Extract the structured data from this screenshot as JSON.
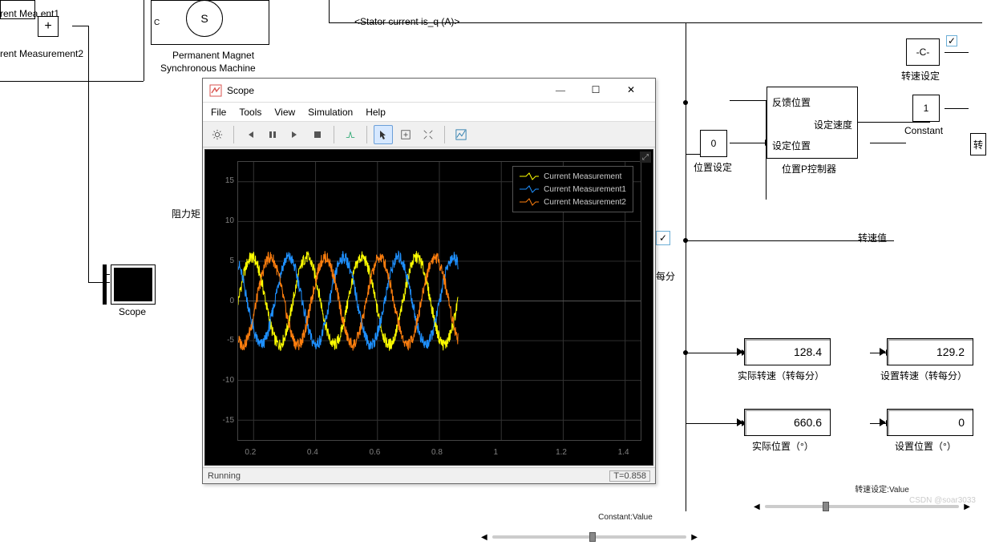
{
  "simulink": {
    "signal_label": "<Stator current is_q (A)>",
    "blocks": {
      "current_meas1": "rent Mea      ent1",
      "current_meas2": "rent Measurement2",
      "pmsm_line1": "Permanent Magnet",
      "pmsm_line2": "Synchronous Machine",
      "pmsm_symbol": "S",
      "port_C": "C",
      "resistance_torque": "阻力矩",
      "scope_block": "Scope",
      "pos_controller_block": "位置P控制器",
      "pos_setpoint": "位置设定",
      "feedback_pos": "反馈位置",
      "set_speed": "设定速度",
      "set_position": "设定位置",
      "speed_setpoint_block": "转速设定",
      "const_C": "-C-",
      "constant_block": "Constant",
      "constant_1": "1",
      "constant_0": "0",
      "speed_value_label": "转速值",
      "per_minute": "每分",
      "partial_gain": "转"
    },
    "displays": {
      "actual_speed": {
        "value": "128.4",
        "label": "实际转速（转每分）"
      },
      "set_speed": {
        "value": "129.2",
        "label": "设置转速（转每分）"
      },
      "actual_pos": {
        "value": "660.6",
        "label": "实际位置（°）"
      },
      "set_pos": {
        "value": "0",
        "label": "设置位置（°）"
      }
    },
    "sliders": {
      "speed": "转速设定:Value",
      "constant": "Constant:Value"
    },
    "watermark": "CSDN @soar3033"
  },
  "scope_window": {
    "title": "Scope",
    "menu": [
      "File",
      "Tools",
      "View",
      "Simulation",
      "Help"
    ],
    "status_left": "Running",
    "status_right": "T=0.858",
    "legend": [
      "Current Measurement",
      "Current Measurement1",
      "Current Measurement2"
    ],
    "colors": {
      "yellow": "#ffff00",
      "blue": "#1e90ff",
      "orange": "#ff7f0e"
    }
  },
  "chart_data": {
    "type": "line",
    "title": "",
    "xlabel": "",
    "ylabel": "",
    "xlim": [
      0.15,
      1.45
    ],
    "ylim": [
      -17.5,
      17.5
    ],
    "xticks": [
      0.2,
      0.4,
      0.6,
      0.8,
      1,
      1.2,
      1.4
    ],
    "yticks": [
      -15,
      -10,
      -5,
      0,
      5,
      10,
      15
    ],
    "data_x_range": [
      0.15,
      0.86
    ],
    "amplitude": 5.5,
    "periods_in_range": 4,
    "noise_amplitude": 0.8,
    "series": [
      {
        "name": "Current Measurement",
        "color": "yellow",
        "phase_deg": 0
      },
      {
        "name": "Current Measurement1",
        "color": "blue",
        "phase_deg": 120
      },
      {
        "name": "Current Measurement2",
        "color": "orange",
        "phase_deg": 240
      }
    ]
  }
}
